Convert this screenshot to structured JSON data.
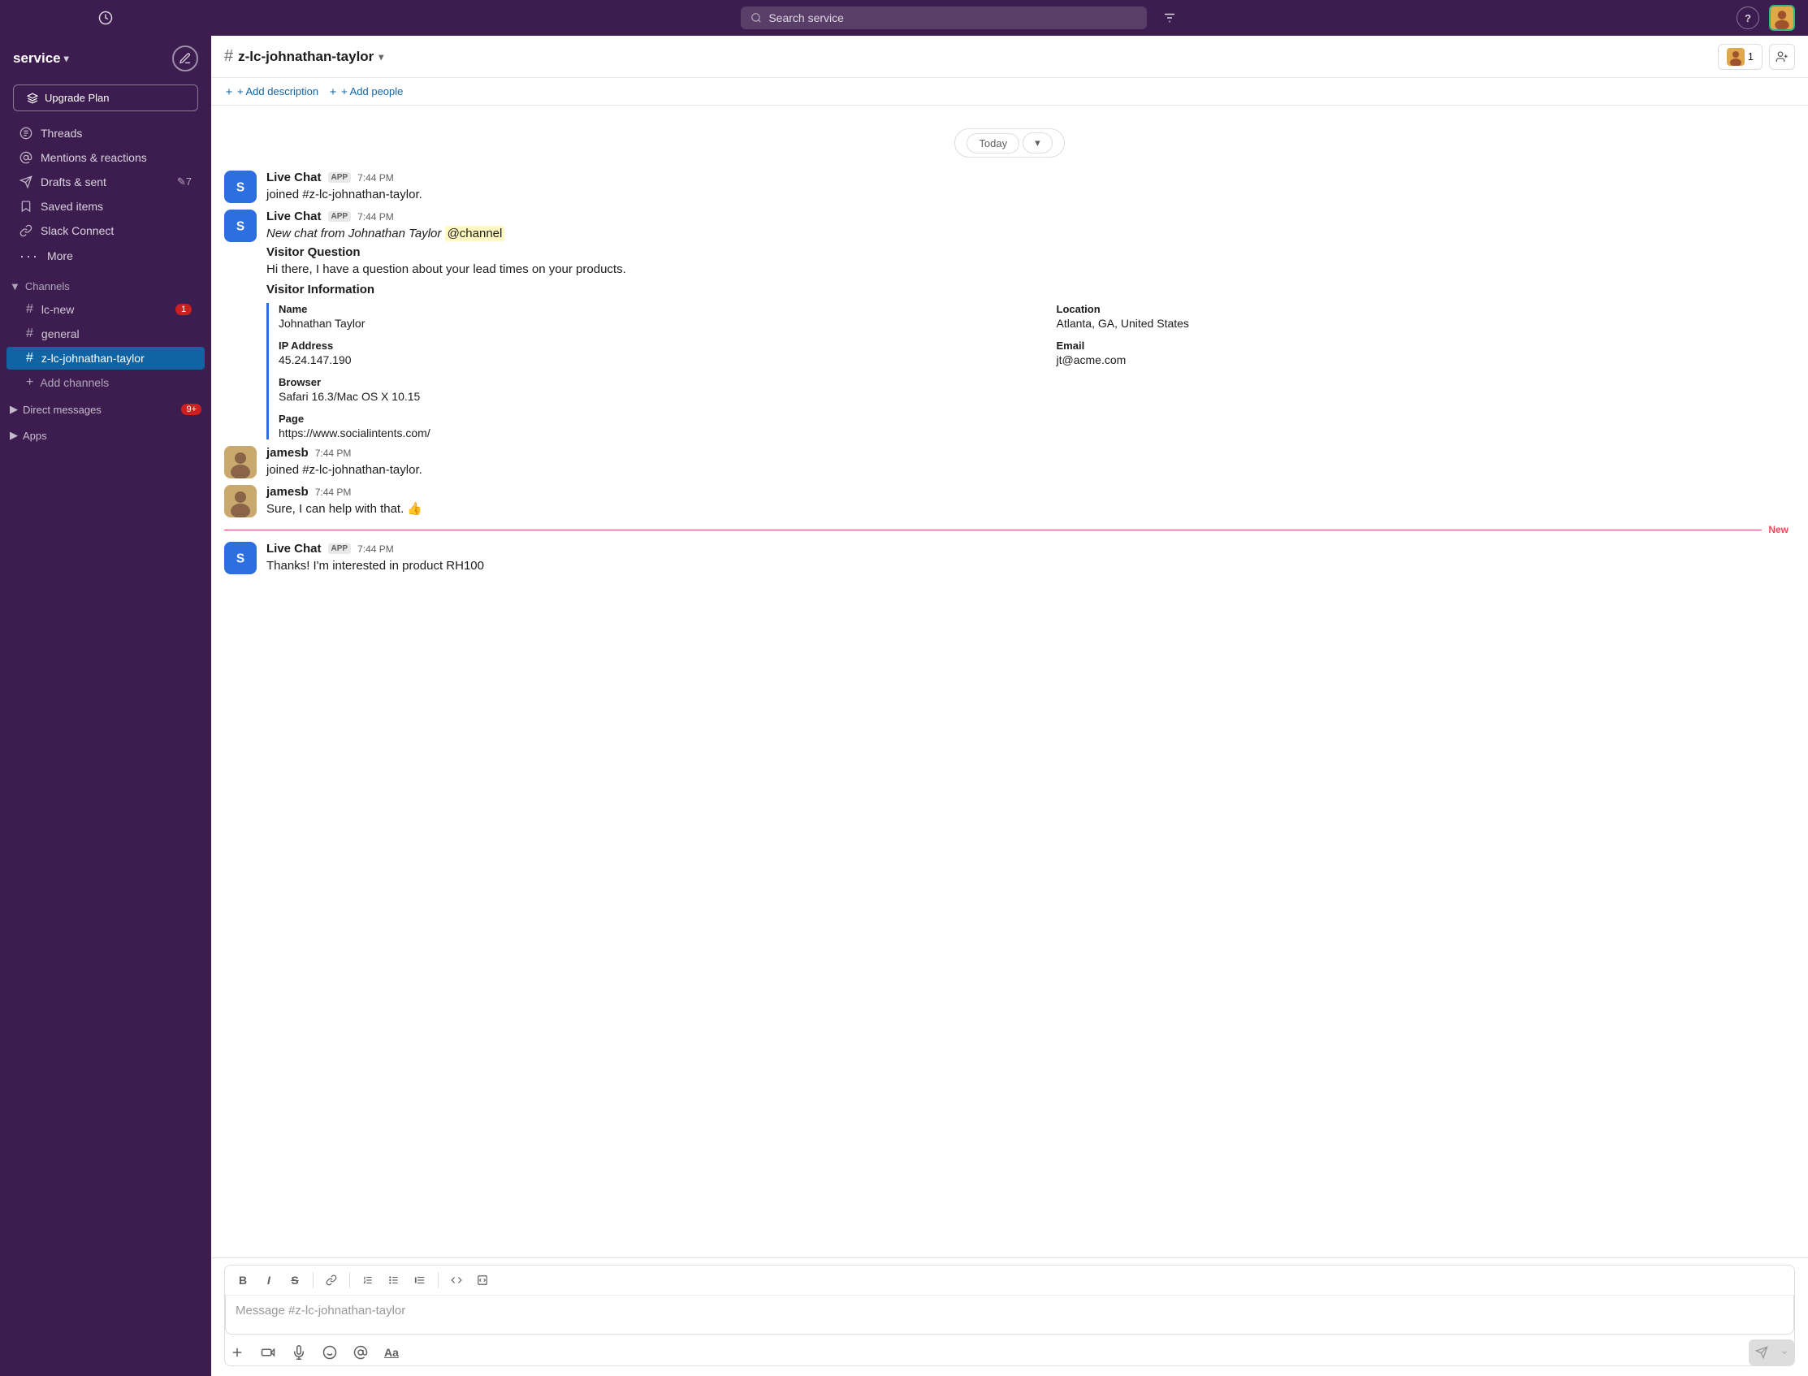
{
  "app": {
    "workspace": "service",
    "workspace_caret": "▾"
  },
  "topbar": {
    "search_placeholder": "Search service",
    "filter_icon": "⚙",
    "help_label": "?",
    "history_icon": "🕐"
  },
  "sidebar": {
    "upgrade_btn": "Upgrade Plan",
    "nav": [
      {
        "id": "threads",
        "label": "Threads",
        "icon": "threads"
      },
      {
        "id": "mentions",
        "label": "Mentions & reactions",
        "icon": "at"
      },
      {
        "id": "drafts",
        "label": "Drafts & sent",
        "icon": "drafts",
        "count": "✎7"
      },
      {
        "id": "saved",
        "label": "Saved items",
        "icon": "bookmark"
      },
      {
        "id": "connect",
        "label": "Slack Connect",
        "icon": "connect"
      },
      {
        "id": "more",
        "label": "More",
        "icon": "more"
      }
    ],
    "channels_section": "Channels",
    "channels": [
      {
        "id": "lc-new",
        "name": "lc-new",
        "badge": "1"
      },
      {
        "id": "general",
        "name": "general",
        "badge": ""
      },
      {
        "id": "z-lc-johnathan-taylor",
        "name": "z-lc-johnathan-taylor",
        "badge": "",
        "active": true
      }
    ],
    "add_channels": "Add channels",
    "direct_messages": "Direct messages",
    "dm_badge": "9+",
    "apps": "Apps"
  },
  "channel": {
    "hash": "#",
    "name": "z-lc-johnathan-taylor",
    "caret": "▾",
    "add_description": "+ Add description",
    "add_people": "+ Add people",
    "member_count": "1"
  },
  "date_divider": {
    "label": "Today",
    "caret": "▾"
  },
  "messages": [
    {
      "id": "msg1",
      "sender": "Live Chat",
      "app": true,
      "time": "7:44 PM",
      "text": "joined #z-lc-johnathan-taylor.",
      "avatar_type": "blue-s"
    },
    {
      "id": "msg2",
      "sender": "Live Chat",
      "app": true,
      "time": "7:44 PM",
      "has_channel_mention": true,
      "mention_text": "@channel",
      "pre_mention": "New chat from Johnathan Taylor ",
      "visitor_question_title": "Visitor Question",
      "visitor_question": "Hi there, I have a question about your lead times on your products.",
      "visitor_info_title": "Visitor Information",
      "fields": [
        {
          "label": "Name",
          "value": "Johnathan Taylor",
          "col": 1
        },
        {
          "label": "Location",
          "value": "Atlanta, GA, United States",
          "col": 2
        },
        {
          "label": "IP Address",
          "value": "45.24.147.190",
          "col": 1
        },
        {
          "label": "Email",
          "value": "jt@acme.com",
          "col": 2
        },
        {
          "label": "Browser",
          "value": "Safari 16.3/Mac OS X 10.15",
          "col": 1
        },
        {
          "label": "Page",
          "value": "https://www.socialintents.com/",
          "col": 1,
          "span": true
        }
      ],
      "avatar_type": "blue-s"
    },
    {
      "id": "msg3",
      "sender": "jamesb",
      "app": false,
      "time": "7:44 PM",
      "text": "joined #z-lc-johnathan-taylor.",
      "avatar_type": "user"
    },
    {
      "id": "msg4",
      "sender": "jamesb",
      "app": false,
      "time": "7:44 PM",
      "text": "Sure, I can help with that. 👍",
      "avatar_type": "user"
    },
    {
      "id": "msg5",
      "sender": "Live Chat",
      "app": true,
      "time": "7:44 PM",
      "text": "Thanks!  I'm interested in product RH100",
      "avatar_type": "blue-s",
      "is_new": true
    }
  ],
  "new_badge": "New",
  "input": {
    "placeholder": "Message #z-lc-johnathan-taylor",
    "toolbar": [
      "B",
      "I",
      "S",
      "🔗",
      "≡",
      "≡",
      "≡",
      "</>",
      "□"
    ]
  }
}
